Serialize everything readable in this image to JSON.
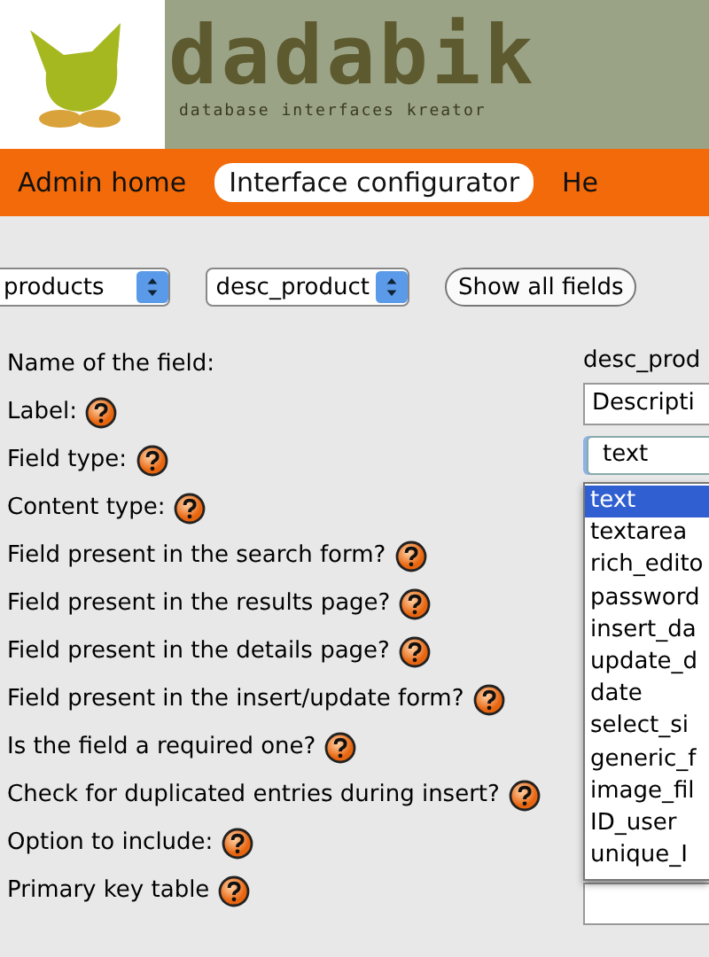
{
  "logo": {
    "wordmark": "dadabik",
    "tagline": "database interfaces kreator"
  },
  "nav": [
    {
      "label": "Admin home",
      "selected": false
    },
    {
      "label": "Interface configurator",
      "selected": true
    },
    {
      "label": "He",
      "selected": false
    }
  ],
  "toolbar": {
    "table_select": "products",
    "field_select": "desc_product",
    "button": "Show all fields"
  },
  "fields": [
    {
      "label": "Name of the field:",
      "help": false
    },
    {
      "label": "Label:",
      "help": true
    },
    {
      "label": "Field type:",
      "help": true
    },
    {
      "label": "Content type:",
      "help": true
    },
    {
      "label": "Field present in the search form?",
      "help": true
    },
    {
      "label": "Field present in the results page?",
      "help": true
    },
    {
      "label": "Field present in the details page?",
      "help": true
    },
    {
      "label": "Field present in the insert/update form?",
      "help": true
    },
    {
      "label": "Is the field a required one?",
      "help": true
    },
    {
      "label": "Check for duplicated entries during insert?",
      "help": true
    },
    {
      "label": "Option to include:",
      "help": true
    },
    {
      "label": "Primary key table",
      "help": true
    }
  ],
  "values": {
    "name": "desc_prod",
    "label_input": "Descripti",
    "field_type": "text"
  },
  "field_type_options": [
    {
      "label": "text",
      "selected": true
    },
    {
      "label": "textarea",
      "selected": false
    },
    {
      "label": "rich_edito",
      "selected": false
    },
    {
      "label": "password",
      "selected": false
    },
    {
      "label": "insert_da",
      "selected": false
    },
    {
      "label": "update_d",
      "selected": false
    },
    {
      "label": "date",
      "selected": false
    },
    {
      "label": "select_si",
      "selected": false
    },
    {
      "label": "generic_f",
      "selected": false
    },
    {
      "label": "image_fil",
      "selected": false
    },
    {
      "label": "ID_user",
      "selected": false
    },
    {
      "label": "unique_I",
      "selected": false
    }
  ]
}
